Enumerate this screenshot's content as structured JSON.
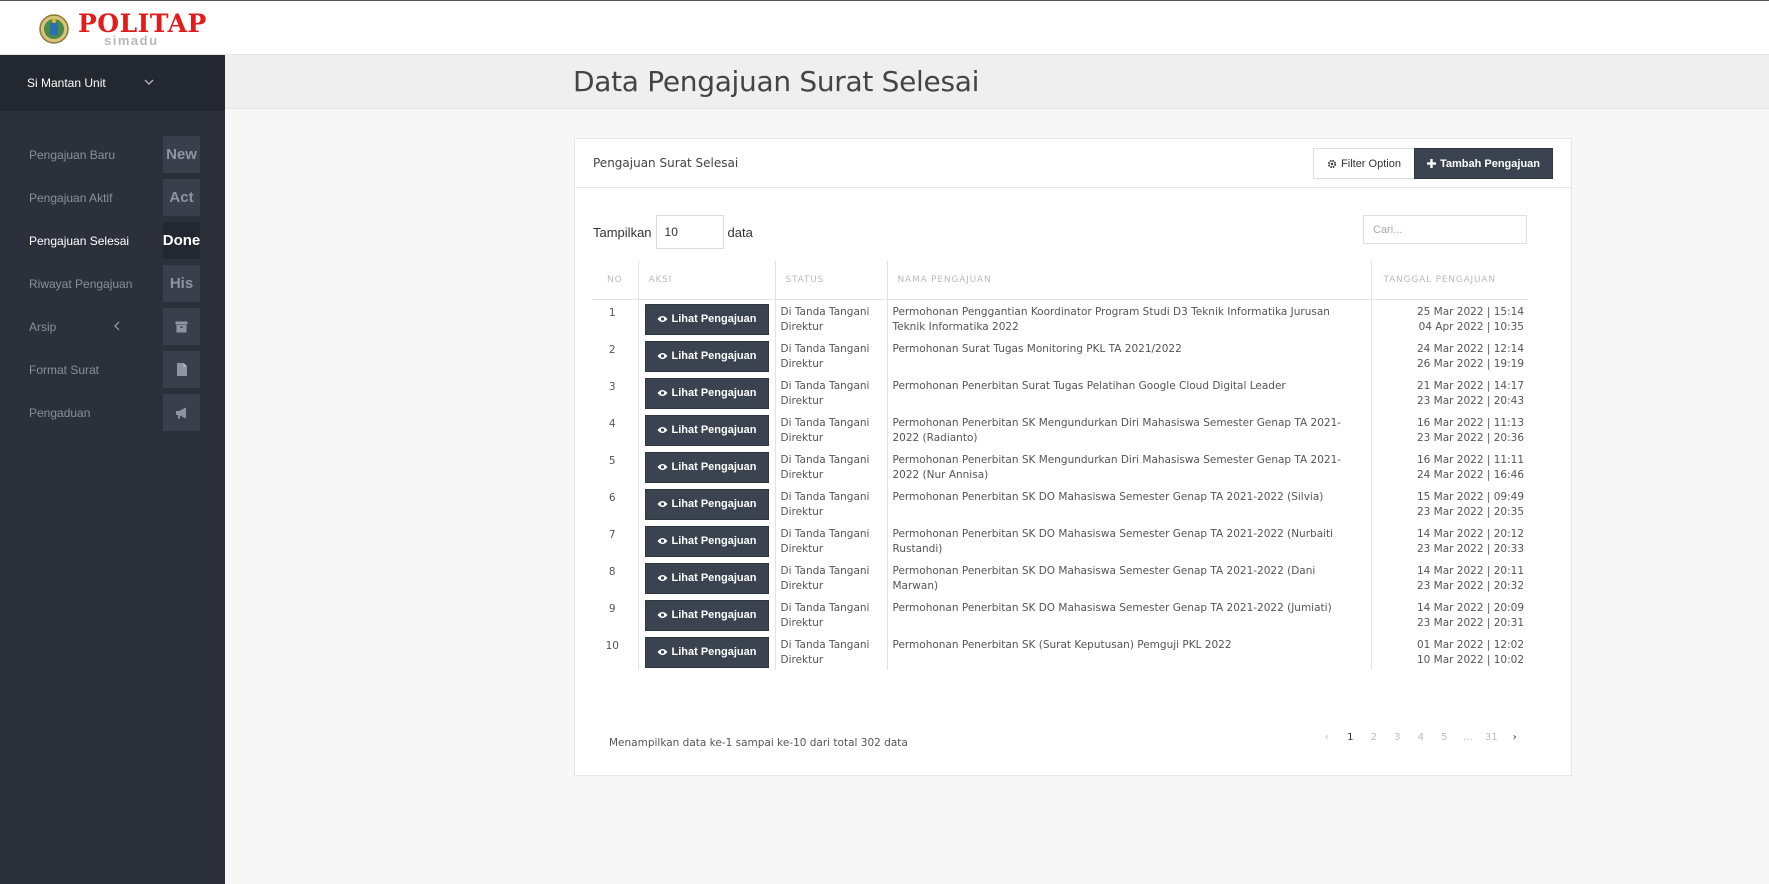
{
  "header": {
    "logo_text": "POLITAP",
    "logo_subtext": "simadu"
  },
  "sidebar": {
    "user_name": "Si Mantan Unit",
    "items": [
      {
        "label": "Pengajuan Baru",
        "badge": "New",
        "icon": ""
      },
      {
        "label": "Pengajuan Aktif",
        "badge": "Act",
        "icon": ""
      },
      {
        "label": "Pengajuan Selesai",
        "badge": "Done",
        "icon": "",
        "active": true
      },
      {
        "label": "Riwayat Pengajuan",
        "badge": "His",
        "icon": ""
      },
      {
        "label": "Arsip",
        "badge": "",
        "icon": "archive-icon"
      },
      {
        "label": "Format Surat",
        "badge": "",
        "icon": "file-icon"
      },
      {
        "label": "Pengaduan",
        "badge": "",
        "icon": "megaphone-icon"
      }
    ]
  },
  "main": {
    "page_title": "Data Pengajuan Surat Selesai",
    "panel_title": "Pengajuan Surat Selesai",
    "filter_label": "Filter Option",
    "add_label": "Tambah Pengajuan",
    "length": {
      "prefix": "Tampilkan",
      "value": "10",
      "suffix": "data"
    },
    "search": {
      "placeholder": "Cari..."
    },
    "columns": [
      "NO",
      "AKSI",
      "STATUS",
      "NAMA PENGAJUAN",
      "TANGGAL PENGAJUAN"
    ],
    "action_label": "Lihat Pengajuan",
    "rows": [
      {
        "no": "1",
        "status1": "Di Tanda Tangani",
        "status2": "Direktur",
        "nama": "Permohonan Penggantian Koordinator Program Studi D3 Teknik Informatika Jurusan Teknik Informatika 2022",
        "tgl1": "25 Mar 2022 | 15:14",
        "tgl2": "04 Apr 2022 | 10:35"
      },
      {
        "no": "2",
        "status1": "Di Tanda Tangani",
        "status2": "Direktur",
        "nama": "Permohonan Surat Tugas Monitoring PKL TA 2021/2022",
        "tgl1": "24 Mar 2022 | 12:14",
        "tgl2": "26 Mar 2022 | 19:19"
      },
      {
        "no": "3",
        "status1": "Di Tanda Tangani",
        "status2": "Direktur",
        "nama": "Permohonan Penerbitan Surat Tugas Pelatihan Google Cloud Digital Leader",
        "tgl1": "21 Mar 2022 | 14:17",
        "tgl2": "23 Mar 2022 | 20:43"
      },
      {
        "no": "4",
        "status1": "Di Tanda Tangani",
        "status2": "Direktur",
        "nama": "Permohonan Penerbitan SK Mengundurkan Diri Mahasiswa Semester Genap TA 2021-2022 (Radianto)",
        "tgl1": "16 Mar 2022 | 11:13",
        "tgl2": "23 Mar 2022 | 20:36"
      },
      {
        "no": "5",
        "status1": "Di Tanda Tangani",
        "status2": "Direktur",
        "nama": "Permohonan Penerbitan SK Mengundurkan Diri Mahasiswa Semester Genap TA 2021-2022 (Nur Annisa)",
        "tgl1": "16 Mar 2022 | 11:11",
        "tgl2": "24 Mar 2022 | 16:46"
      },
      {
        "no": "6",
        "status1": "Di Tanda Tangani",
        "status2": "Direktur",
        "nama": "Permohonan Penerbitan SK DO Mahasiswa Semester Genap TA 2021-2022 (Silvia)",
        "tgl1": "15 Mar 2022 | 09:49",
        "tgl2": "23 Mar 2022 | 20:35"
      },
      {
        "no": "7",
        "status1": "Di Tanda Tangani",
        "status2": "Direktur",
        "nama": "Permohonan Penerbitan SK DO Mahasiswa Semester Genap TA 2021-2022 (Nurbaiti Rustandi)",
        "tgl1": "14 Mar 2022 | 20:12",
        "tgl2": "23 Mar 2022 | 20:33"
      },
      {
        "no": "8",
        "status1": "Di Tanda Tangani",
        "status2": "Direktur",
        "nama": "Permohonan Penerbitan SK DO Mahasiswa Semester Genap TA 2021-2022 (Dani Marwan)",
        "tgl1": "14 Mar 2022 | 20:11",
        "tgl2": "23 Mar 2022 | 20:32"
      },
      {
        "no": "9",
        "status1": "Di Tanda Tangani",
        "status2": "Direktur",
        "nama": "Permohonan Penerbitan SK DO Mahasiswa Semester Genap TA 2021-2022 (Jumiati)",
        "tgl1": "14 Mar 2022 | 20:09",
        "tgl2": "23 Mar 2022 | 20:31"
      },
      {
        "no": "10",
        "status1": "Di Tanda Tangani",
        "status2": "Direktur",
        "nama": "Permohonan Penerbitan SK (Surat Keputusan) Pemguji PKL 2022",
        "tgl1": "01 Mar 2022 | 12:02",
        "tgl2": "10 Mar 2022 | 10:02"
      }
    ],
    "info_text": "Menampilkan data ke-1 sampai ke-10 dari total 302 data",
    "pagination": {
      "prev": "‹",
      "pages": [
        "1",
        "2",
        "3",
        "4",
        "5",
        "...",
        "31"
      ],
      "current": "1",
      "next": "›"
    }
  },
  "colors": {
    "sidebar_bg": "#2b303a",
    "button_dark": "#3a434f",
    "logo_red": "#e41b1b"
  }
}
